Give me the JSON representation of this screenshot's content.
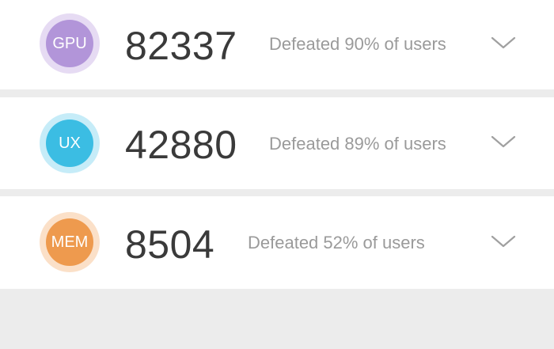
{
  "scores": [
    {
      "badge_label": "GPU",
      "score": "82337",
      "defeated_text": "Defeated 90% of users",
      "badge_inner_color": "#b295d9",
      "badge_ring_color": "#e6dbf3",
      "icon": "chevron-down-icon"
    },
    {
      "badge_label": "UX",
      "score": "42880",
      "defeated_text": "Defeated 89% of users",
      "badge_inner_color": "#3bbde3",
      "badge_ring_color": "#c6ecf8",
      "icon": "chevron-down-icon"
    },
    {
      "badge_label": "MEM",
      "score": "8504",
      "defeated_text": "Defeated 52% of users",
      "badge_inner_color": "#ee9a4e",
      "badge_ring_color": "#fbe0c8",
      "icon": "chevron-down-icon"
    }
  ]
}
